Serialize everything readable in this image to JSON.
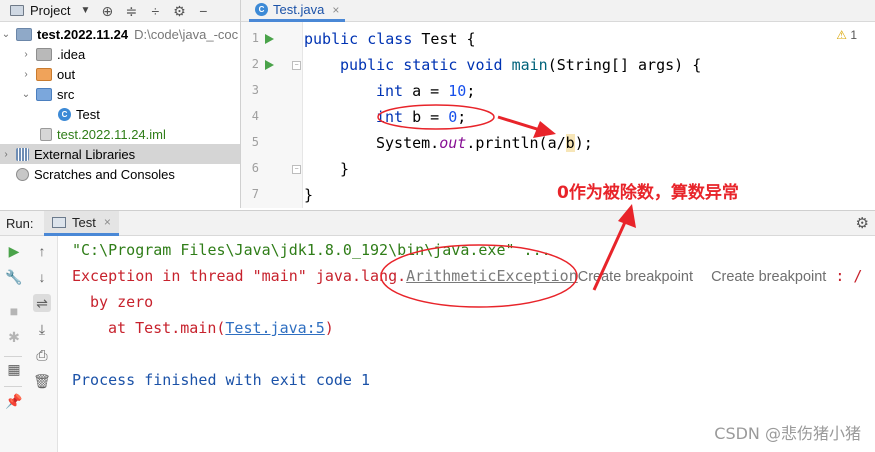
{
  "project": {
    "title": "Project",
    "tree": [
      {
        "label": "test.2022.11.24",
        "path": "D:\\code\\java_-coc"
      },
      {
        "label": ".idea"
      },
      {
        "label": "out"
      },
      {
        "label": "src"
      },
      {
        "label": "Test"
      },
      {
        "label": "test.2022.11.24.iml"
      },
      {
        "label": "External Libraries"
      },
      {
        "label": "Scratches and Consoles"
      }
    ]
  },
  "editor": {
    "tab_label": "Test.java",
    "warning_count": "1",
    "line_numbers": [
      "1",
      "2",
      "3",
      "4",
      "5",
      "6",
      "7"
    ],
    "code": {
      "l1_kw": "public class",
      "l1_rest": " Test {",
      "l2_kw": "public static void",
      "l2_fn": "main",
      "l2_rest": "(String[] args) {",
      "l3_kw": "int",
      "l3_mid": " a = ",
      "l3_num": "10",
      "l3_end": ";",
      "l4_kw": "int",
      "l4_mid": " b = ",
      "l4_num": "0",
      "l4_end": ";",
      "l5_a": "System.",
      "l5_out": "out",
      "l5_b": ".println(a/",
      "l5_hl": "b",
      "l5_c": ");",
      "l6": "}",
      "l7": "}"
    }
  },
  "annotation": "0作为被除数，算数异常",
  "run": {
    "label": "Run:",
    "tab_label": "Test",
    "console": {
      "line1": "\"C:\\Program Files\\Java\\jdk1.8.0_192\\bin\\java.exe\" ...",
      "line2_prefix": "Exception in thread \"main\" java.lang.",
      "line2_exception": "ArithmeticException",
      "line2_hint1": "Create breakpoint",
      "line2_hint2": "Create breakpoint",
      "line2_suffix": " : /",
      "line3": "by zero",
      "line4_prefix": "at Test.main(",
      "line4_link": "Test.java:5",
      "line4_suffix": ")",
      "line6": "Process finished with exit code 1"
    }
  },
  "watermark": "CSDN @悲伤猪小猪",
  "colors": {
    "keyword": "#0033b3",
    "number": "#1750eb",
    "error": "#c7222d",
    "annotation": "#e8242a"
  }
}
